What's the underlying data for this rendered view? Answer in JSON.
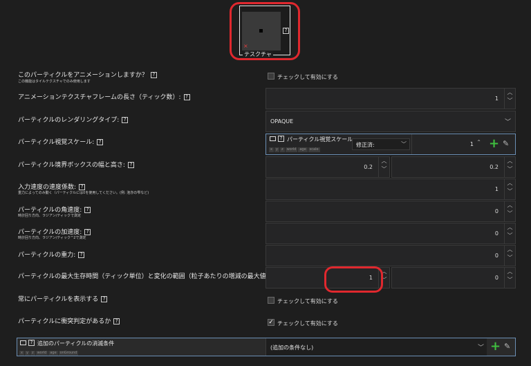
{
  "texture": {
    "label": "テスクチャ",
    "help": "?"
  },
  "rows": [
    {
      "id": "animate",
      "label": "このパーティクルをアニメーションしますか？",
      "sub": "この機能はタイルテクスチャでのみ使用します",
      "help": "?"
    },
    {
      "id": "frame_len",
      "label": "アニメーションテクスチャフレームの長さ（ティック数）:",
      "help": "?"
    },
    {
      "id": "render_type",
      "label": "パーティクルのレンダリングタイプ:",
      "help": "?"
    },
    {
      "id": "visual_scale",
      "label": "パーティクル視覚スケール:",
      "help": "?"
    },
    {
      "id": "bbox",
      "label": "パーティクル境界ボックスの幅と高さ:",
      "help": "?"
    },
    {
      "id": "speed_factor",
      "label": "入力速度の速度係数:",
      "sub": "重力によってのみ動く（パーティクルには0を使用してください。(例: 泡亦の雫など)",
      "help": "?"
    },
    {
      "id": "angular",
      "label": "パーティクルの角速度:",
      "sub": "時計回り方向、ラジアン/ティックで測定",
      "help": "?"
    },
    {
      "id": "accel",
      "label": "パーティクルの加速度:",
      "sub": "時計回り方向、ラジアン/ティック^2で測定",
      "help": "?"
    },
    {
      "id": "gravity",
      "label": "パーティクルの重力:",
      "help": "?"
    },
    {
      "id": "lifetime",
      "label": "パーティクルの最大生存時間（ティック単位）と変化の範囲（粒子あたりの増減の最大値）:",
      "help": "?"
    },
    {
      "id": "always_show",
      "label": "常にパーティクルを表示する",
      "help": "?"
    },
    {
      "id": "collision",
      "label": "パーティクルに衝突判定があるか",
      "help": "?"
    }
  ],
  "checkbox_label": "チェックして有効にする",
  "values": {
    "frame_len": "1",
    "render_type": "OPAQUE",
    "visual_scale": "1",
    "bbox_w": "0.2",
    "bbox_h": "0.2",
    "speed_factor": "1",
    "angular": "0",
    "accel": "0",
    "gravity": "0",
    "lifetime": "1",
    "lifetime_range": "0"
  },
  "scale_proc": {
    "title": "パーティクル視覚スケール:",
    "dropdown": "修正済:",
    "tags": [
      "x",
      "y",
      "z",
      "world",
      "age",
      "scale"
    ]
  },
  "despawn": {
    "title": "追加のパーティクルの消滅条件",
    "tags": [
      "x",
      "y",
      "z",
      "world",
      "age",
      "onGround"
    ],
    "value": "(追加の条件なし)"
  },
  "checks": {
    "animate": false,
    "always_show": false,
    "collision": true
  },
  "colors": {
    "bg": "#1e1e1e",
    "field": "#252526",
    "highlight": "#e0282e",
    "add": "#3fbf3f"
  }
}
